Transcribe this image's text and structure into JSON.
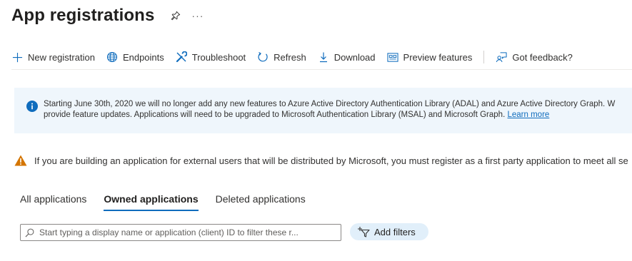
{
  "header": {
    "title": "App registrations",
    "pin_icon": "pin-icon",
    "more_label": "···"
  },
  "toolbar": {
    "new_registration": "New registration",
    "endpoints": "Endpoints",
    "troubleshoot": "Troubleshoot",
    "refresh": "Refresh",
    "download": "Download",
    "preview_features": "Preview features",
    "got_feedback": "Got feedback?"
  },
  "info_banner": {
    "line1": "Starting June 30th, 2020 we will no longer add any new features to Azure Active Directory Authentication Library (ADAL) and Azure Active Directory Graph. W",
    "line2": "provide feature updates. Applications will need to be upgraded to Microsoft Authentication Library (MSAL) and Microsoft Graph.",
    "link": "Learn more"
  },
  "warning_banner": {
    "text": "If you are building an application for external users that will be distributed by Microsoft, you must register as a first party application to meet all se"
  },
  "tabs": [
    {
      "label": "All applications",
      "active": false
    },
    {
      "label": "Owned applications",
      "active": true
    },
    {
      "label": "Deleted applications",
      "active": false
    }
  ],
  "search": {
    "placeholder": "Start typing a display name or application (client) ID to filter these r...",
    "value": ""
  },
  "filter": {
    "label": "Add filters"
  },
  "colors": {
    "accent": "#0f6cbd",
    "info_bg": "#eff6fc",
    "warning": "#d47500",
    "filter_bg": "#e1effa"
  }
}
